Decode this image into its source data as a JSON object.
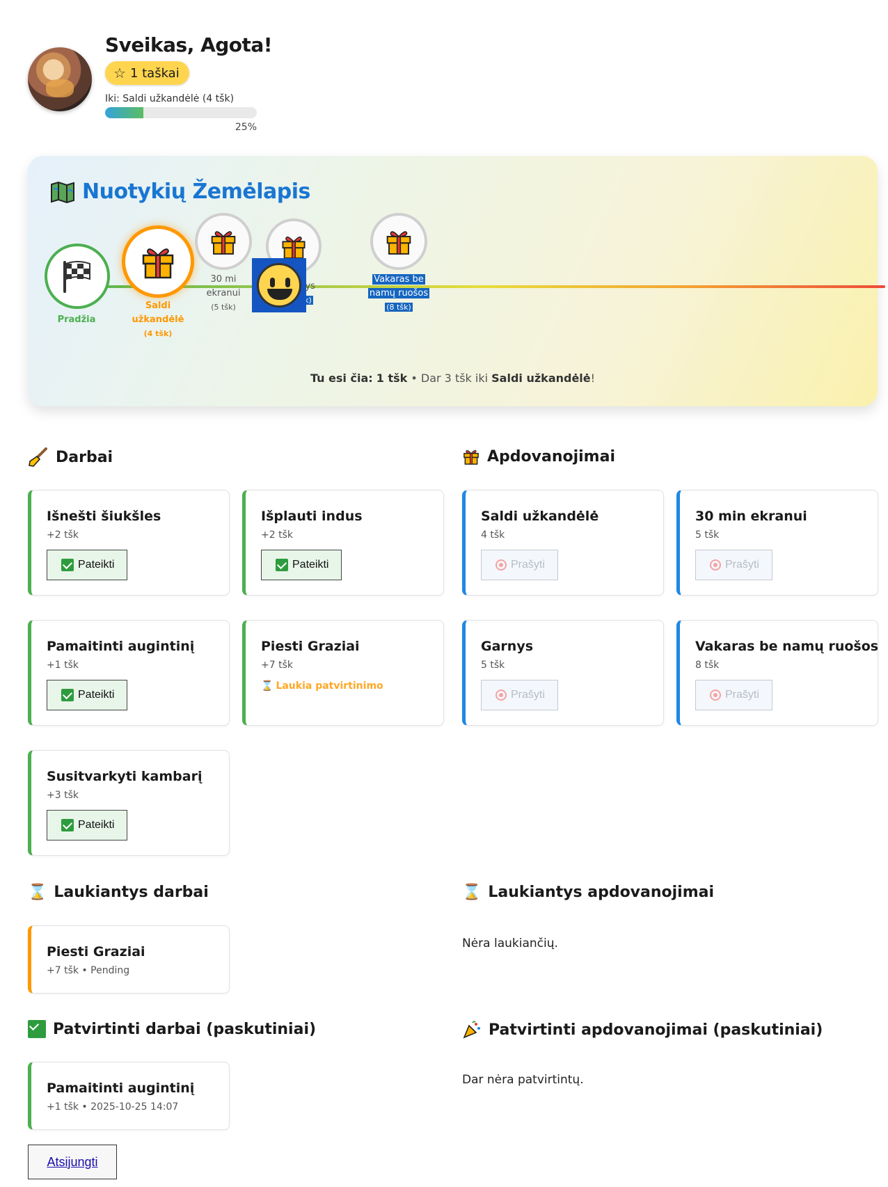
{
  "header": {
    "greeting": "Sveikas, Agota!",
    "points": "1 taškai",
    "goal_label": "Iki: Saldi užkandėlė (4 tšk)",
    "progress_percent": 25,
    "progress_text": "25%"
  },
  "map": {
    "title": "Nuotykių Žemėlapis",
    "nodes": [
      {
        "label": "Pradžia",
        "pts": ""
      },
      {
        "label_line1": "Saldi",
        "label_line2": "užkandėlė",
        "pts": "(4 tšk)"
      },
      {
        "label_line1": "30 mi",
        "label_line2": "ekranui",
        "pts": "(5 tšk)"
      },
      {
        "label_line1": "Garnys",
        "pts": "(5 tšk)"
      },
      {
        "label_line1": "Vakaras be",
        "label_line2": "namų ruošos",
        "pts": "(8 tšk)"
      }
    ],
    "status_prefix": "Tu esi čia:",
    "status_points": "1 tšk",
    "status_middle": "• Dar 3 tšk iki",
    "status_goal": "Saldi užkandėlė",
    "status_suffix": "!"
  },
  "chores": {
    "title": "Darbai",
    "items": [
      {
        "title": "Išnešti šiukšles",
        "meta": "+2 tšk",
        "button": "Pateikti"
      },
      {
        "title": "Išplauti indus",
        "meta": "+2 tšk",
        "button": "Pateikti"
      },
      {
        "title": "Pamaitinti augintinį",
        "meta": "+1 tšk",
        "button": "Pateikti"
      },
      {
        "title": "Piesti Graziai",
        "meta": "+7 tšk",
        "status": "Laukia patvirtinimo"
      },
      {
        "title": "Susitvarkyti kambarį",
        "meta": "+3 tšk",
        "button": "Pateikti"
      }
    ]
  },
  "rewards": {
    "title": "Apdovanojimai",
    "items": [
      {
        "title": "Saldi užkandėlė",
        "meta": "4 tšk",
        "button": "Prašyti"
      },
      {
        "title": "30 min ekranui",
        "meta": "5 tšk",
        "button": "Prašyti"
      },
      {
        "title": "Garnys",
        "meta": "5 tšk",
        "button": "Prašyti"
      },
      {
        "title": "Vakaras be namų ruošos",
        "meta": "8 tšk",
        "button": "Prašyti"
      }
    ]
  },
  "pending_chores": {
    "title": "Laukiantys darbai",
    "items": [
      {
        "title": "Piesti Graziai",
        "meta": "+7 tšk • Pending"
      }
    ]
  },
  "pending_rewards": {
    "title": "Laukiantys apdovanojimai",
    "empty": "Nėra laukiančių."
  },
  "approved_chores": {
    "title": "Patvirtinti darbai (paskutiniai)",
    "items": [
      {
        "title": "Pamaitinti augintinį",
        "meta": "+1 tšk • 2025-10-25 14:07"
      }
    ]
  },
  "approved_rewards": {
    "title": "Patvirtinti apdovanojimai (paskutiniai)",
    "empty": "Dar nėra patvirtintų."
  },
  "logout": "Atsijungti"
}
